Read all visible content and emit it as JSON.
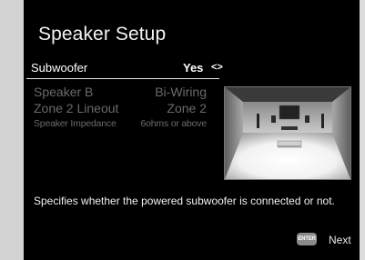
{
  "screen": {
    "title": "Speaker Setup",
    "selected_item": {
      "label": "Subwoofer",
      "value": "Yes",
      "arrows": "<>"
    },
    "items": [
      {
        "label": "Speaker B",
        "value": "Bi-Wiring"
      },
      {
        "label": "Zone 2 Lineout",
        "value": "Zone 2"
      },
      {
        "label": "Speaker Impedance",
        "value": "6ohms or above"
      }
    ],
    "description": "Specifies whether the powered subwoofer is connected or not.",
    "footer": {
      "enter_label": "ENTER",
      "next_label": "Next"
    }
  },
  "colors": {
    "background": "#000000",
    "selected_text": "#ffffff",
    "dim_text": "#6a6a6a",
    "gutter": "#d4d4d4"
  },
  "icons": [
    "room-illustration",
    "enter-key-icon"
  ]
}
